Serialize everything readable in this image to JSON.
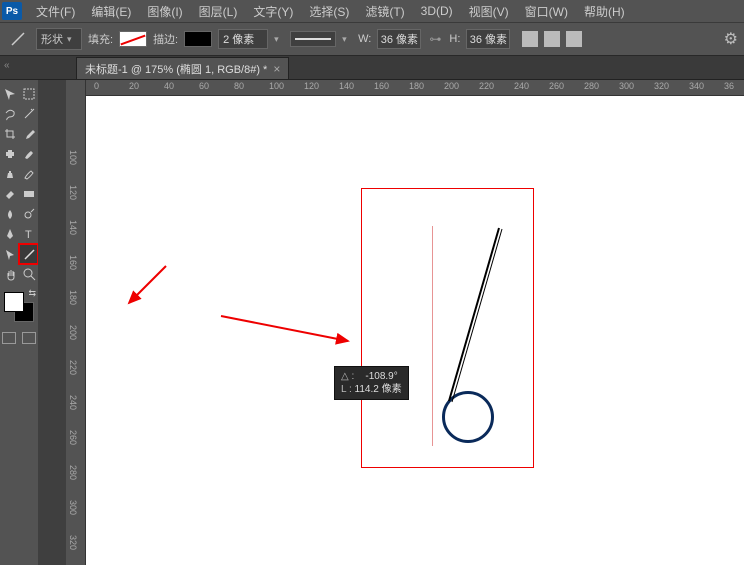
{
  "menubar": {
    "logo": "Ps",
    "items": [
      "文件(F)",
      "编辑(E)",
      "图像(I)",
      "图层(L)",
      "文字(Y)",
      "选择(S)",
      "滤镜(T)",
      "3D(D)",
      "视图(V)",
      "窗口(W)",
      "帮助(H)"
    ]
  },
  "optionsbar": {
    "shape_mode": "形状",
    "fill_label": "填充:",
    "stroke_label": "描边:",
    "stroke_width": "2 像素",
    "width_label": "W:",
    "width_value": "36 像素",
    "height_label": "H:",
    "height_value": "36 像素"
  },
  "tab": {
    "title": "未标题-1 @ 175% (椭圆 1, RGB/8#) *"
  },
  "ruler_h": [
    "0",
    "20",
    "40",
    "60",
    "80",
    "100",
    "120",
    "140",
    "160",
    "180",
    "200",
    "220",
    "240",
    "260",
    "280",
    "300",
    "320",
    "340",
    "36"
  ],
  "ruler_v": [
    "100",
    "120",
    "140",
    "160",
    "180",
    "200",
    "220",
    "240",
    "260",
    "280",
    "300",
    "320"
  ],
  "info": {
    "angle_label": "△ :",
    "angle_value": "-108.9°",
    "length_label": "L :",
    "length_value": "114.2 像素"
  },
  "colors": {
    "fg": "#ffffff",
    "bg": "#000000",
    "accent_red": "#e00000",
    "circle_stroke": "#0a2a5a"
  }
}
